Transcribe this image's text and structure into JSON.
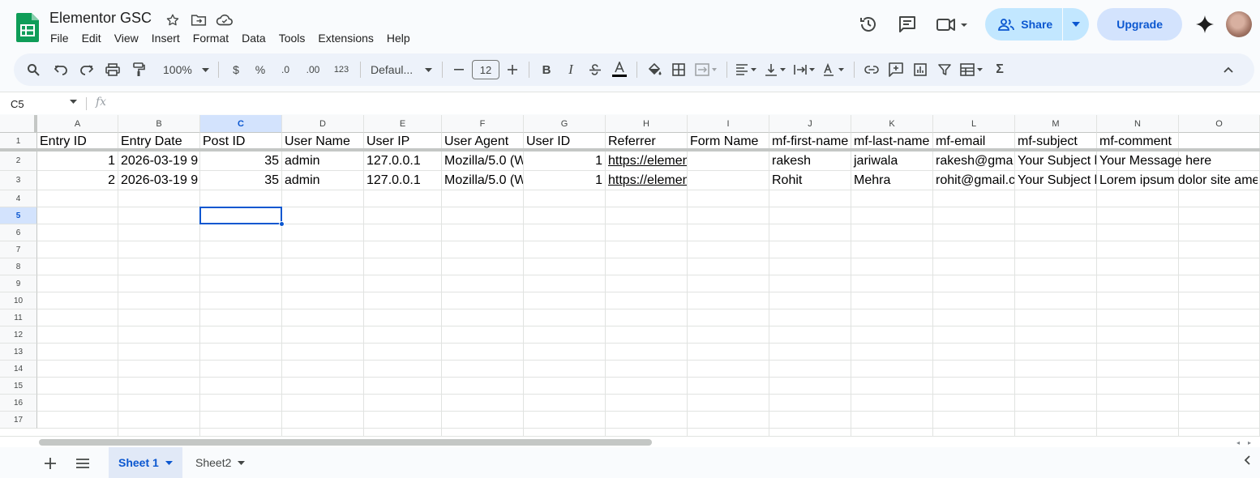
{
  "doc": {
    "title": "Elementor GSC"
  },
  "menu": [
    "File",
    "Edit",
    "View",
    "Insert",
    "Format",
    "Data",
    "Tools",
    "Extensions",
    "Help"
  ],
  "header": {
    "share_label": "Share",
    "upgrade_label": "Upgrade"
  },
  "toolbar": {
    "zoom": "100%",
    "currency": "$",
    "percent": "%",
    "dec_less": ".0",
    "dec_more": ".00",
    "format_123": "123",
    "font": "Defaul...",
    "font_size": "12"
  },
  "formula_bar": {
    "cell_ref": "C5",
    "fx": "fx",
    "value": ""
  },
  "grid": {
    "columns": [
      "A",
      "B",
      "C",
      "D",
      "E",
      "F",
      "G",
      "H",
      "I",
      "J",
      "K",
      "L",
      "M",
      "N",
      "O"
    ],
    "selected_column": "C",
    "rows": [
      "1",
      "2",
      "3",
      "4",
      "5",
      "6",
      "7",
      "8",
      "9",
      "10",
      "11",
      "12",
      "13",
      "14",
      "15",
      "16",
      "17"
    ],
    "selected_row": "5",
    "header_row": [
      "Entry ID",
      "Entry Date",
      "Post ID",
      "User Name",
      "User IP",
      "User Agent",
      "User ID",
      "Referrer",
      "Form Name",
      "mf-first-name",
      "mf-last-name",
      "mf-email",
      "mf-subject",
      "mf-comment",
      ""
    ],
    "data_rows": [
      [
        "1",
        "2026-03-19 9",
        "35",
        "admin",
        "127.0.0.1",
        "Mozilla/5.0 (W",
        "1",
        "https://elementor-gsc.com/m",
        "",
        "rakesh",
        "jariwala",
        "rakesh@gma",
        "Your Subject l",
        "Your Message here",
        ""
      ],
      [
        "2",
        "2026-03-19 9",
        "35",
        "admin",
        "127.0.0.1",
        "Mozilla/5.0 (W",
        "1",
        "https://elementor-gsc.com/m",
        "",
        "Rohit",
        "Mehra",
        "rohit@gmail.c",
        "Your Subject l",
        "Lorem ipsum dolor site amet",
        ""
      ]
    ]
  },
  "sheets": [
    {
      "name": "Sheet 1",
      "active": true
    },
    {
      "name": "Sheet2",
      "active": false
    }
  ],
  "colors": {
    "accent": "#0b57d0",
    "share_bg": "#c2e7ff",
    "upgrade_bg": "#d3e3fd",
    "sheets_green": "#0f9d58"
  }
}
